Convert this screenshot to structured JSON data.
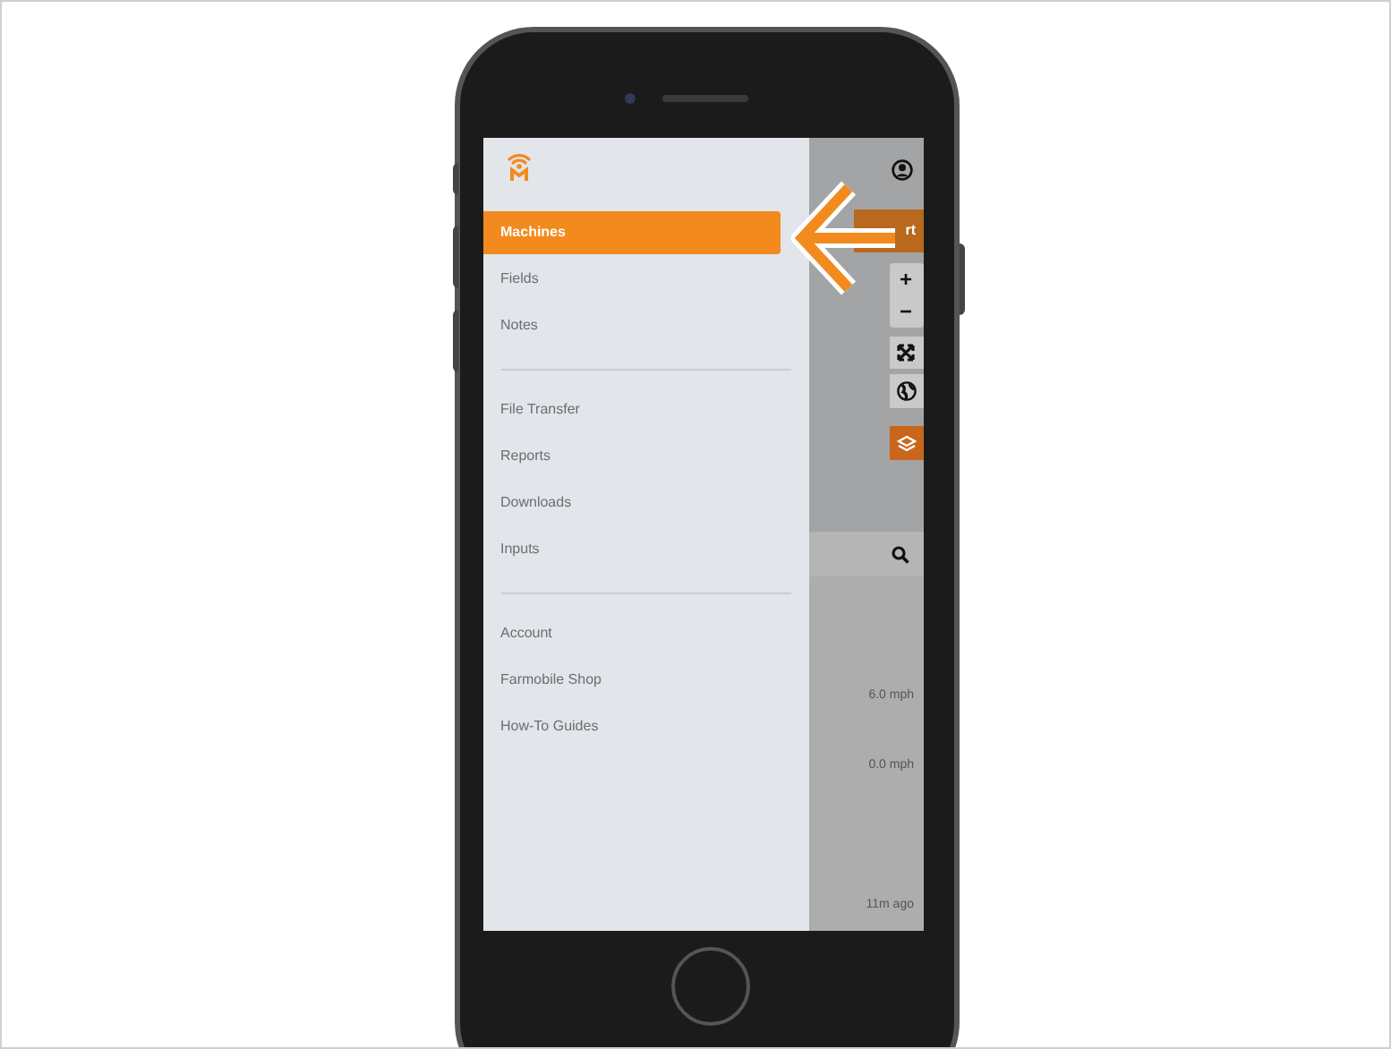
{
  "menu": {
    "groups": [
      {
        "items": [
          {
            "label": "Machines",
            "selected": true
          },
          {
            "label": "Fields",
            "selected": false
          },
          {
            "label": "Notes",
            "selected": false
          }
        ]
      },
      {
        "items": [
          {
            "label": "File Transfer",
            "selected": false
          },
          {
            "label": "Reports",
            "selected": false
          },
          {
            "label": "Downloads",
            "selected": false
          },
          {
            "label": "Inputs",
            "selected": false
          }
        ]
      },
      {
        "items": [
          {
            "label": "Account",
            "selected": false
          },
          {
            "label": "Farmobile Shop",
            "selected": false
          },
          {
            "label": "How-To Guides",
            "selected": false
          }
        ]
      }
    ]
  },
  "map_panel": {
    "action_button": "rt",
    "zoom_in": "+",
    "zoom_out": "−"
  },
  "list": [
    "6.0 mph",
    "0.0 mph",
    "11m ago"
  ]
}
